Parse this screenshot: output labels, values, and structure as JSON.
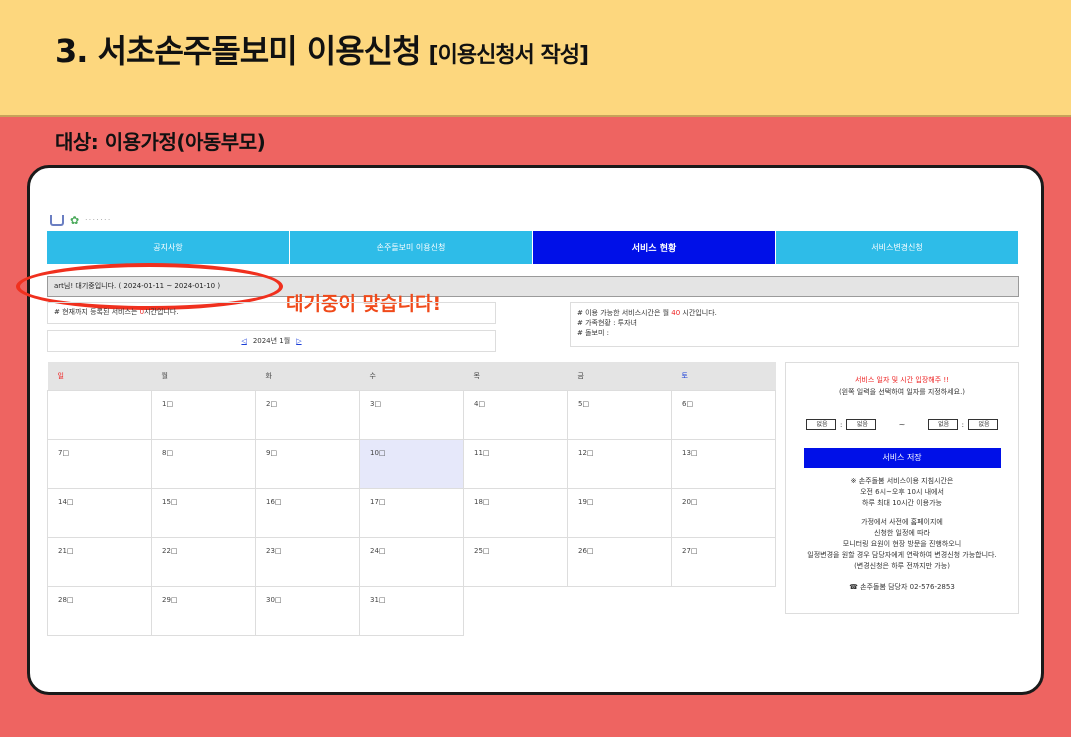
{
  "slide": {
    "title": "3. 서초손주돌보미 이용신청",
    "title_sub": "[이용신청서 작성]",
    "target": "대상: 이용가정(아동부모)"
  },
  "nav": {
    "items": [
      "공지사항",
      "손주돌보미 이용신청",
      "서비스 현황",
      "서비스변경신청"
    ],
    "active_index": 2
  },
  "status": {
    "wait_text": "art님! 대기중입니다. ( 2024-01-11 ~ 2024-01-10 )",
    "callout": "대기중이 맞습니다!"
  },
  "info_left": {
    "prefix": "# 현재까지 등록된 서비스는 ",
    "hours": "0",
    "suffix": "시간입니다."
  },
  "month_nav": {
    "prev": "◁",
    "label": "2024년 1월",
    "next": "▷"
  },
  "info_right": {
    "line1_prefix": "# 이용 가능한 서비스시간은 월 ",
    "line1_hours": "40",
    "line1_suffix": " 시간입니다.",
    "line2": "# 가족현황 : 투자녀",
    "line3": "# 돌보미 :"
  },
  "calendar": {
    "weekdays": [
      "일",
      "월",
      "화",
      "수",
      "목",
      "금",
      "토"
    ],
    "weeks": [
      [
        "",
        "1□",
        "2□",
        "3□",
        "4□",
        "5□",
        "6□"
      ],
      [
        "7□",
        "8□",
        "9□",
        "10□",
        "11□",
        "12□",
        "13□"
      ],
      [
        "14□",
        "15□",
        "16□",
        "17□",
        "18□",
        "19□",
        "20□"
      ],
      [
        "21□",
        "22□",
        "23□",
        "24□",
        "25□",
        "26□",
        "27□"
      ],
      [
        "28□",
        "29□",
        "30□",
        "31□",
        "",
        "",
        ""
      ]
    ],
    "highlight_day": "10□"
  },
  "side_panel": {
    "title": "서비스 일자 및 시간 입장해주 !!",
    "subtitle": "(왼쪽 일력을 선택하여 일자를 지정하세요.)",
    "start_hour": "없음",
    "start_minute": "없음",
    "separator": "~",
    "end_hour": "없음",
    "end_minute": "없음",
    "colon": ":",
    "save_label": "서비스 저장",
    "notice_1": "※ 손주돌봄 서비스이용 지침시간은",
    "notice_2": "오전 6시~오후 10시 내에서",
    "notice_3": "하루 최대 10시간 이용가능",
    "notice_4": "가정에서 사전에 홈페이지에",
    "notice_5": "신청한 일정에 따라",
    "notice_6": "모니터링 요원이 현장 방문을 진행하오니",
    "notice_7": "일정변경을 원할 경우 담당자에게 연락하여 변경신청 가능합니다.",
    "notice_8": "(변경신청은 하루 전까지만 가능)",
    "contact": "☎ 손주돌봄 담당자 02-576-2853"
  }
}
